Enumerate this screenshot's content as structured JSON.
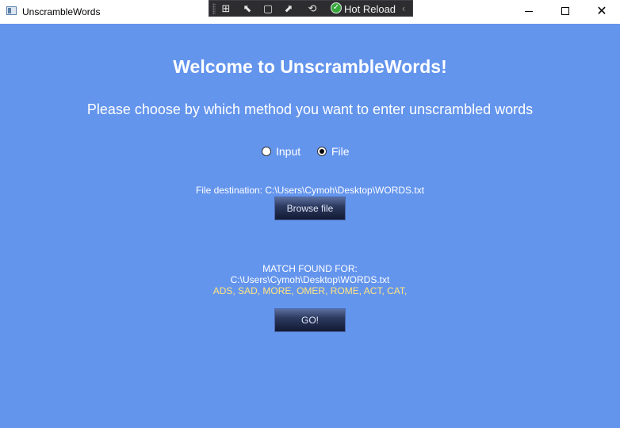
{
  "window": {
    "title": "UnscrambleWords",
    "icons": {
      "app": "app-window-icon",
      "minimize": "minimize-icon",
      "maximize": "maximize-icon",
      "close": "close-icon"
    },
    "close_glyph": "✕"
  },
  "dev_toolbar": {
    "hot_reload_label": "Hot Reload",
    "tool_icons": [
      "live-visual-tree-icon",
      "select-element-icon",
      "display-layout-adorners-icon",
      "track-focused-element-icon",
      "binding-failures-icon"
    ],
    "tool_glyphs": [
      "⊞",
      "⬉",
      "▢",
      "⬈",
      "⟲"
    ],
    "check_glyph": "✓",
    "collapse_glyph": "‹"
  },
  "main": {
    "heading": "Welcome to UnscrambleWords!",
    "subheading": "Please choose by which method you want to enter unscrambled words",
    "options": [
      {
        "label": "Input",
        "selected": false
      },
      {
        "label": "File",
        "selected": true
      }
    ],
    "file_destination": "File destination: C:\\Users\\Cymoh\\Desktop\\WORDS.txt",
    "browse_button": "Browse file",
    "match_title": "MATCH FOUND FOR:",
    "match_path": "C:\\Users\\Cymoh\\Desktop\\WORDS.txt",
    "match_words": "ADS, SAD, MORE, OMER, ROME, ACT, CAT,",
    "go_button": "GO!"
  },
  "colors": {
    "background": "#6495ED",
    "text": "#FFFFFF",
    "match_words": "#FFE57F",
    "button_dark": "#1B2545"
  }
}
